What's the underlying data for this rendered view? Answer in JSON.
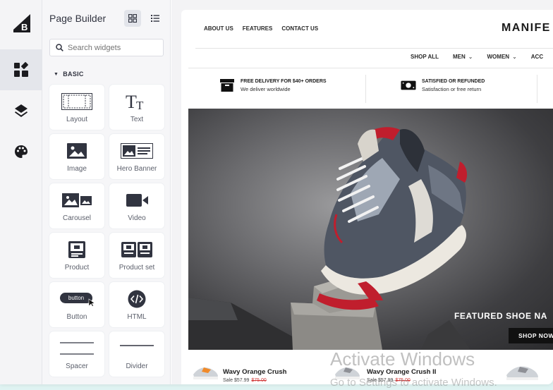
{
  "panel": {
    "title": "Page Builder",
    "search_placeholder": "Search widgets",
    "section_label": "BASIC",
    "widgets": [
      {
        "label": "Layout",
        "icon": "layout-icon"
      },
      {
        "label": "Text",
        "icon": "text-icon"
      },
      {
        "label": "Image",
        "icon": "image-icon"
      },
      {
        "label": "Hero Banner",
        "icon": "hero-banner-icon"
      },
      {
        "label": "Carousel",
        "icon": "carousel-icon"
      },
      {
        "label": "Video",
        "icon": "video-icon"
      },
      {
        "label": "Product",
        "icon": "product-icon"
      },
      {
        "label": "Product set",
        "icon": "product-set-icon"
      },
      {
        "label": "Button",
        "icon": "button-icon",
        "sample_text": "button"
      },
      {
        "label": "HTML",
        "icon": "code-icon"
      },
      {
        "label": "Spacer",
        "icon": "spacer-icon"
      },
      {
        "label": "Divider",
        "icon": "divider-icon"
      }
    ]
  },
  "rail": {
    "items": [
      "widgets-icon",
      "layers-icon",
      "theme-palette-icon"
    ]
  },
  "store": {
    "top_links": [
      "ABOUT US",
      "FEATURES",
      "CONTACT US"
    ],
    "brand": "MANIFE",
    "shop_nav": [
      {
        "label": "SHOP ALL",
        "dropdown": false
      },
      {
        "label": "MEN",
        "dropdown": true
      },
      {
        "label": "WOMEN",
        "dropdown": true
      },
      {
        "label": "ACC",
        "dropdown": false
      }
    ],
    "features": [
      {
        "title": "FREE DELIVERY FOR $40+ ORDERS",
        "subtitle": "We deliver worldwide"
      },
      {
        "title": "SATISFIED OR REFUNDED",
        "subtitle": "Satisfaction or free return"
      }
    ],
    "hero": {
      "title": "FEATURED SHOE NA",
      "button": "SHOP NOW"
    },
    "products": [
      {
        "name": "Wavy Orange Crush",
        "price": "Sale $57.99",
        "old_price": "$75.00"
      },
      {
        "name": "Wavy Orange Crush II",
        "price": "Sale $57.99",
        "old_price": "$75.00"
      }
    ]
  },
  "system": {
    "watermark_title": "Activate Windows",
    "watermark_sub": "Go to Settings to activate Windows."
  },
  "colors": {
    "accent_dark": "#313440",
    "rail_bg": "#f4f4f6",
    "sale_red": "#d23b3b"
  }
}
